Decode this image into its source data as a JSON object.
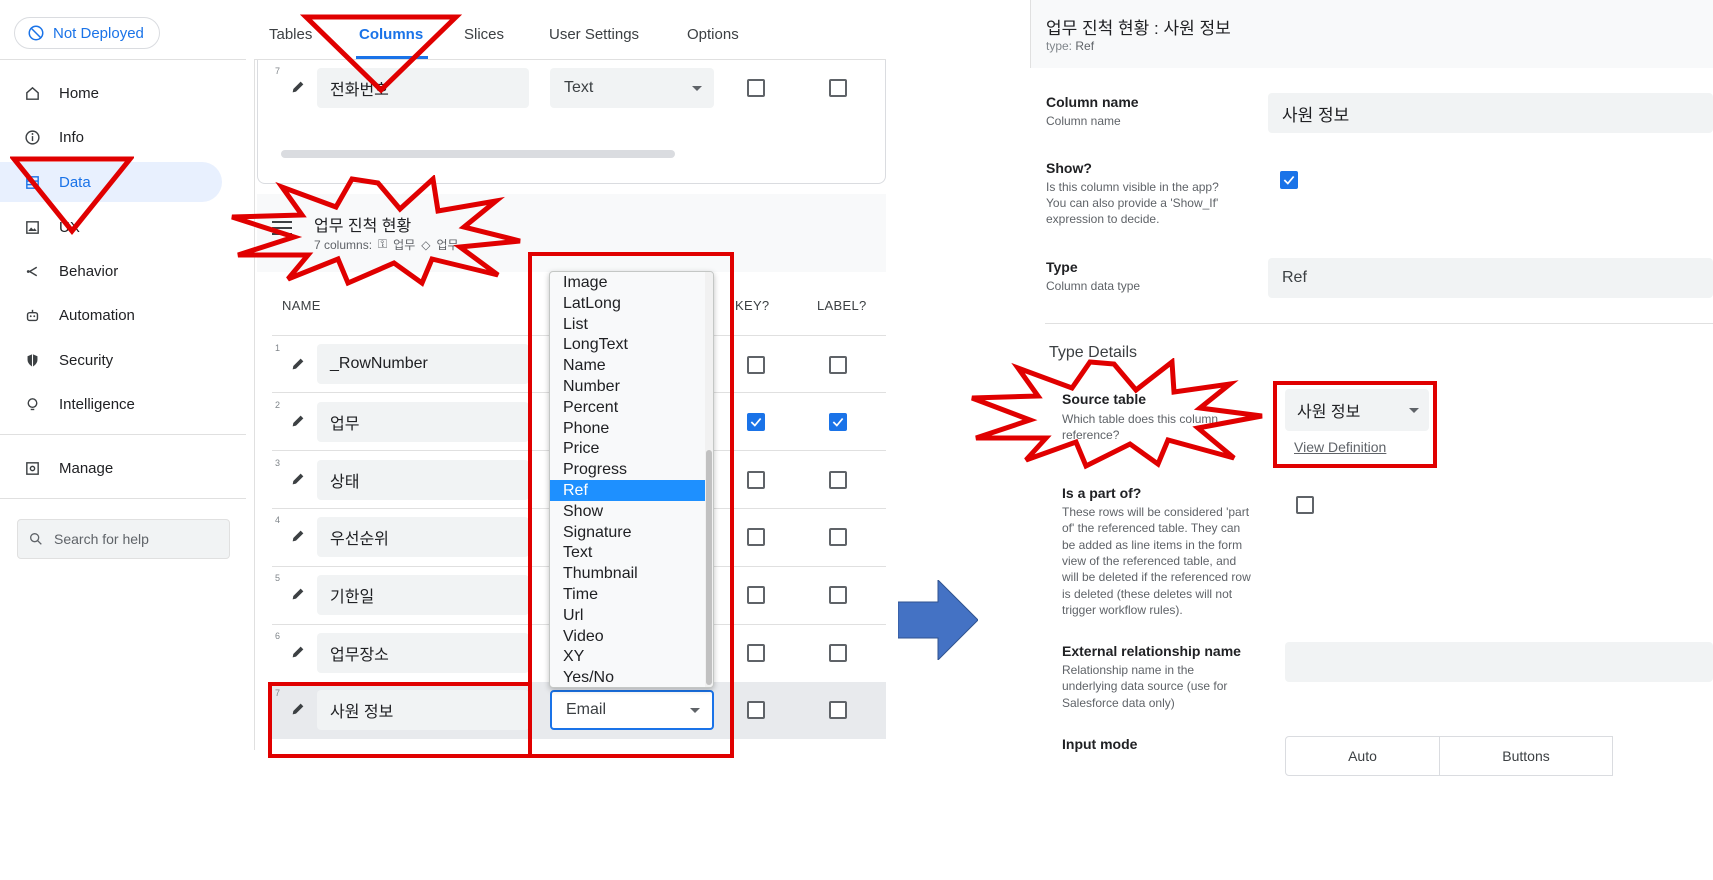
{
  "sidebar": {
    "deploy_status": "Not Deployed",
    "items": [
      {
        "label": "Home",
        "icon": "home-icon"
      },
      {
        "label": "Info",
        "icon": "info-icon"
      },
      {
        "label": "Data",
        "icon": "data-icon",
        "active": true
      },
      {
        "label": "UX",
        "icon": "image-icon"
      },
      {
        "label": "Behavior",
        "icon": "behavior-icon"
      },
      {
        "label": "Automation",
        "icon": "robot-icon"
      },
      {
        "label": "Security",
        "icon": "shield-icon"
      },
      {
        "label": "Intelligence",
        "icon": "lightbulb-icon"
      },
      {
        "label": "Manage",
        "icon": "manage-icon"
      }
    ],
    "help_placeholder": "Search for help"
  },
  "tabs": [
    {
      "label": "Tables"
    },
    {
      "label": "Columns",
      "active": true
    },
    {
      "label": "Slices"
    },
    {
      "label": "User Settings"
    },
    {
      "label": "Options"
    }
  ],
  "top_card": {
    "row_num": "7",
    "name": "전화번호",
    "type": "Text"
  },
  "table_section": {
    "title": "업무 진척 현황",
    "columns_count": "7 columns:",
    "key_col": "업무",
    "label_col": "업무"
  },
  "headers": {
    "name": "NAME",
    "key": "KEY?",
    "label": "LABEL?"
  },
  "rows": [
    {
      "num": "1",
      "name": "_RowNumber",
      "key": false,
      "label": false
    },
    {
      "num": "2",
      "name": "업무",
      "key": true,
      "label": true
    },
    {
      "num": "3",
      "name": "상태",
      "key": false,
      "label": false
    },
    {
      "num": "4",
      "name": "우선순위",
      "key": false,
      "label": false
    },
    {
      "num": "5",
      "name": "기한일",
      "key": false,
      "label": false
    },
    {
      "num": "6",
      "name": "업무장소",
      "key": false,
      "label": false
    },
    {
      "num": "7",
      "name": "사원 정보",
      "type": "Email",
      "key": false,
      "label": false
    }
  ],
  "type_dropdown": {
    "options": [
      "Image",
      "LatLong",
      "List",
      "LongText",
      "Name",
      "Number",
      "Percent",
      "Phone",
      "Price",
      "Progress",
      "Ref",
      "Show",
      "Signature",
      "Text",
      "Thumbnail",
      "Time",
      "Url",
      "Video",
      "XY",
      "Yes/No"
    ],
    "selected": "Ref"
  },
  "detail": {
    "title": "업무 진척 현황 : 사원 정보",
    "type_label": "type:",
    "type_value": "Ref",
    "column_name_label": "Column name",
    "column_name_desc": "Column name",
    "column_name_value": "사원 정보",
    "show_label": "Show?",
    "show_desc_1": "Is this column visible in the app?",
    "show_desc_2": "You can also provide a 'Show_If'",
    "show_desc_3": "expression to decide.",
    "type_field_label": "Type",
    "type_field_desc": "Column data type",
    "type_field_value": "Ref",
    "type_details": "Type Details",
    "source_table_label": "Source table",
    "source_table_desc_1": "Which table does this column",
    "source_table_desc_2": "reference?",
    "source_table_value": "사원 정보",
    "view_definition": "View Definition",
    "part_of_label": "Is a part of?",
    "part_of_desc": [
      "These rows will be considered 'part",
      "of' the referenced table. They can",
      "be added as line items in the form",
      "view of the referenced table, and",
      "will be deleted if the referenced row",
      "is deleted (these deletes will not",
      "trigger workflow rules)."
    ],
    "ext_rel_label": "External relationship name",
    "ext_rel_desc": [
      "Relationship name in the",
      "underlying data source (use for",
      "Salesforce data only)"
    ],
    "input_mode_label": "Input mode",
    "input_mode_auto": "Auto",
    "input_mode_buttons": "Buttons"
  },
  "colors": {
    "accent": "#1a73e8",
    "annotation_red": "#e00000",
    "arrow_blue": "#4472c4",
    "dropdown_selected": "#1e90ff"
  }
}
